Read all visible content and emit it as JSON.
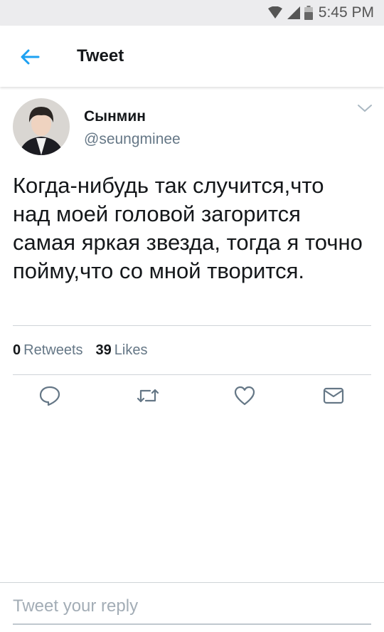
{
  "status_bar": {
    "time": "5:45 PM",
    "icons": [
      "wifi-icon",
      "signal-icon",
      "battery-icon"
    ]
  },
  "header": {
    "title": "Tweet",
    "back_icon": "arrow-left-icon"
  },
  "tweet": {
    "author_name": "Сынмин",
    "author_handle": "@seungminee",
    "text": "Когда-нибудь так случится,что\nнад моей головой загорится\nсамая яркая звезда, тогда я точно\nпойму,что со мной творится.",
    "retweets_count": "0",
    "retweets_label": "Retweets",
    "likes_count": "39",
    "likes_label": "Likes"
  },
  "actions": [
    "reply-icon",
    "retweet-icon",
    "like-icon",
    "direct-message-icon"
  ],
  "reply": {
    "placeholder": "Tweet your reply"
  },
  "colors": {
    "accent": "#1da1f2",
    "secondary_text": "#657786",
    "icon_gray": "#657786"
  }
}
